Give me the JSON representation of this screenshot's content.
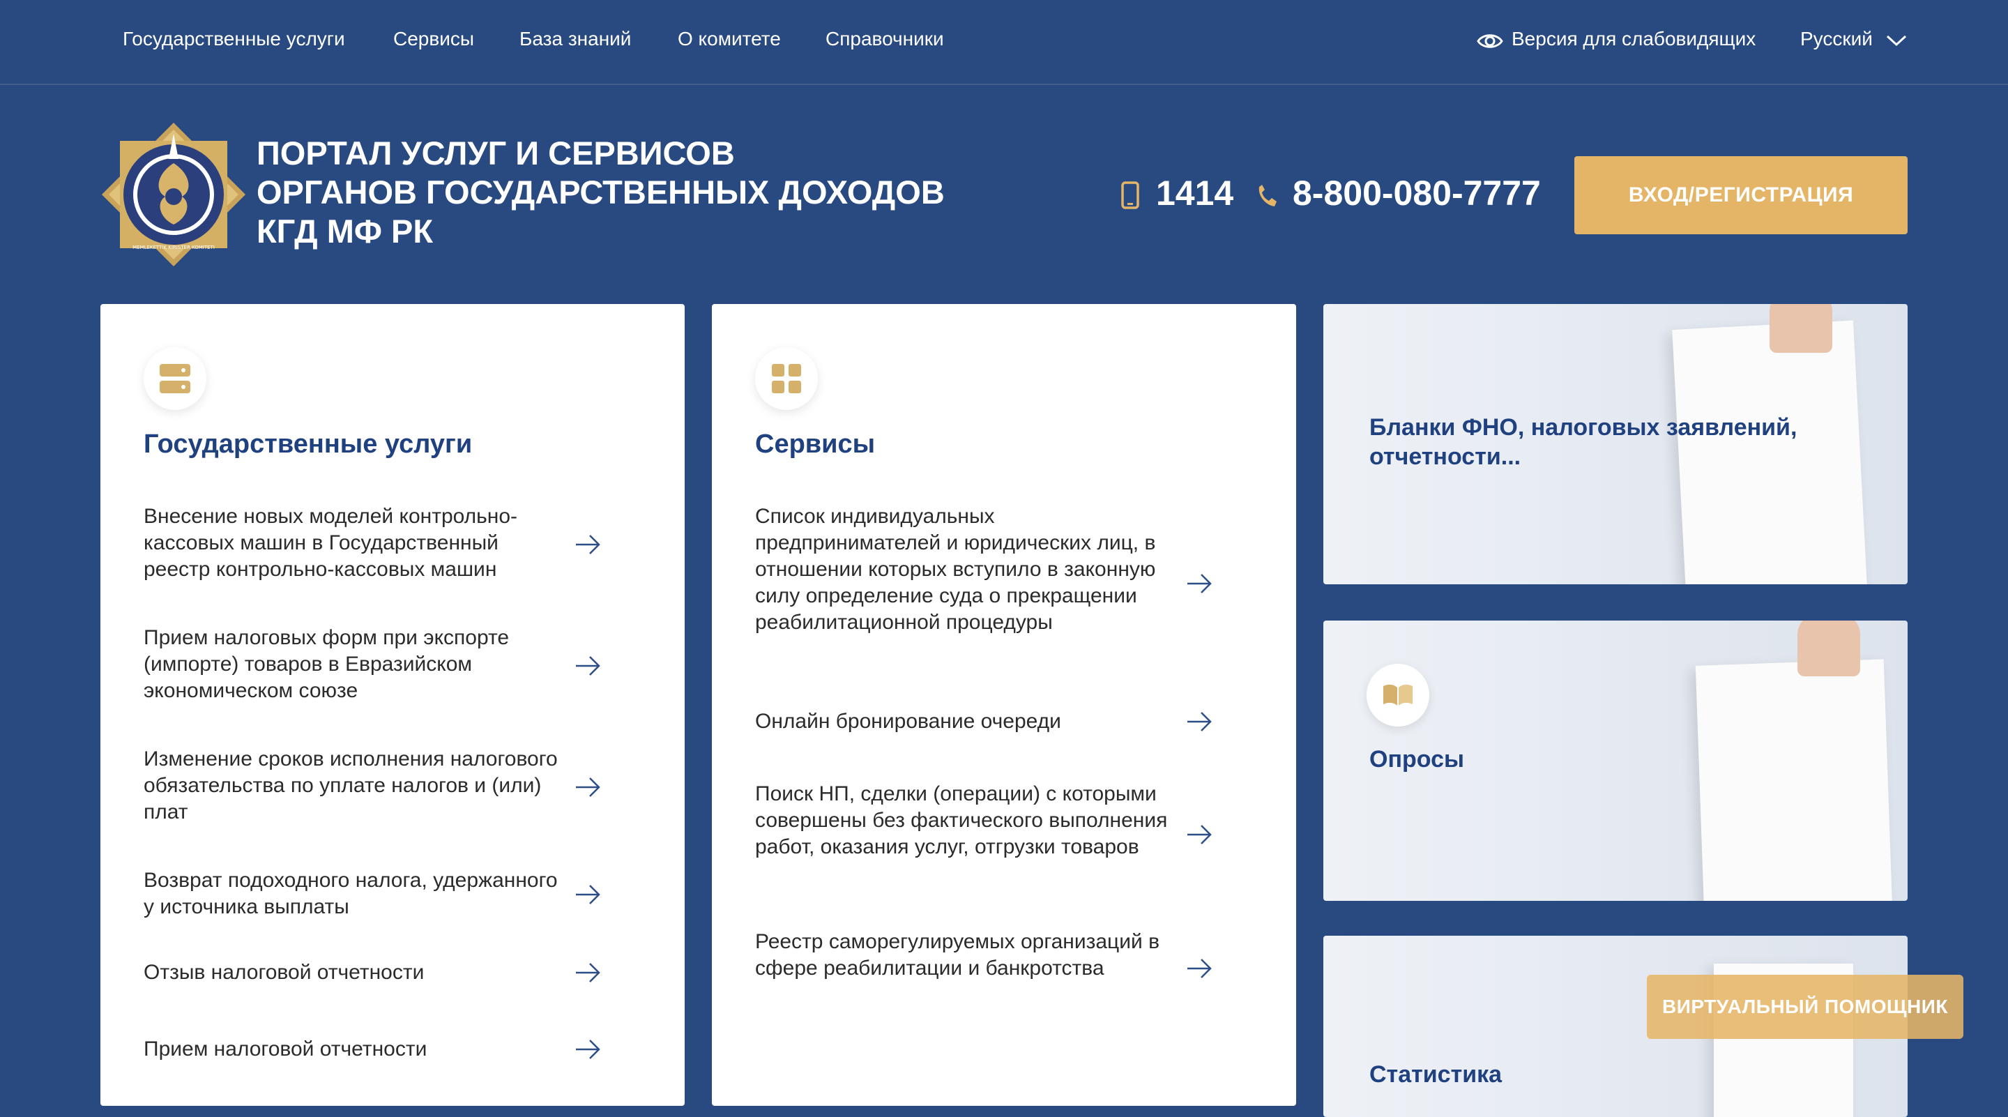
{
  "nav": {
    "items": [
      "Государственные услуги",
      "Сервисы",
      "База знаний",
      "О комитете",
      "Справочники"
    ],
    "accessibility_label": "Версия для слабовидящих",
    "language": "Русский"
  },
  "header": {
    "title_lines": [
      "ПОРТАЛ УСЛУГ И СЕРВИСОВ",
      "ОРГАНОВ ГОСУДАРСТВЕННЫХ ДОХОДОВ",
      "КГД МФ РК"
    ],
    "short_phone": "1414",
    "phone": "8-800-080-7777",
    "login_label": "ВХОД/РЕГИСТРАЦИЯ",
    "logo_ring_text": "MEMLEKETTIK KIRISTER KOMITETI"
  },
  "gov_services": {
    "title": "Государственные услуги",
    "icon": "server-icon",
    "items": [
      "Внесение новых моделей контрольно-кассовых машин в Государственный реестр контрольно-кассовых машин",
      "Прием налоговых форм при экспорте (импорте) товаров в Евразийском экономическом союзе",
      "Изменение сроков исполнения налогового обязательства по уплате налогов и (или) плат",
      "Возврат подоходного налога, удержанного у источника выплаты",
      "Отзыв налоговой отчетности",
      "Прием налоговой отчетности"
    ]
  },
  "services": {
    "title": "Сервисы",
    "icon": "grid-icon",
    "items": [
      "Список индивидуальных предпринимателей и юридических лиц, в отношении которых вступило в законную силу определение суда о прекращении реабилитационной процедуры",
      "Онлайн бронирование очереди",
      "Поиск НП, сделки (операции) с которыми совершены без фактического выполнения работ, оказания услуг, отгрузки товаров",
      "Реестр саморегулируемых организаций в сфере реабилитации и банкротства"
    ]
  },
  "promos": [
    {
      "title": "Бланки ФНО, налоговых заявлений, отчетности..."
    },
    {
      "title": "Опросы",
      "icon": "book-icon"
    },
    {
      "title": "Статистика"
    }
  ],
  "assistant_label": "ВИРТУАЛЬНЫЙ ПОМОЩНИК",
  "colors": {
    "background": "#284a80",
    "accent": "#e5b567",
    "title_blue": "#1f4180"
  }
}
